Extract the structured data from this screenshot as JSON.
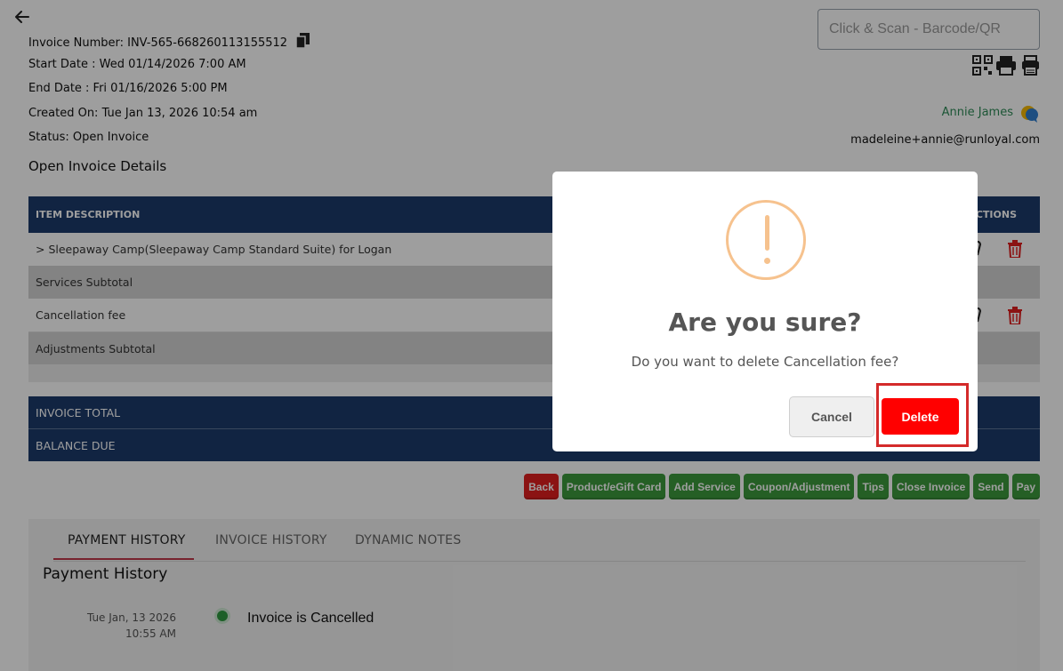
{
  "header": {
    "invoice_number": "Invoice Number: INV-565-668260113155512",
    "start_date": "Start Date : Wed 01/14/2026 7:00 AM",
    "end_date": "End Date : Fri 01/16/2026 5:00 PM",
    "created_on": "Created On: Tue Jan 13, 2026 10:54 am",
    "status": "Status: Open Invoice",
    "section_title": "Open Invoice Details"
  },
  "scan": {
    "placeholder": "Click & Scan - Barcode/QR"
  },
  "customer": {
    "name": "Annie James",
    "email": "madeleine+annie@runloyal.com"
  },
  "table": {
    "col_description": "ITEM DESCRIPTION",
    "col_actions": "ACTIONS",
    "rows": [
      {
        "label": ">  Sleepaway Camp(Sleepaway Camp Standard Suite) for Logan"
      },
      {
        "label": "Services Subtotal"
      },
      {
        "label": "Cancellation fee"
      },
      {
        "label": "Adjustments Subtotal"
      }
    ],
    "invoice_total": "INVOICE TOTAL",
    "balance_due": "BALANCE DUE"
  },
  "buttons": {
    "back": "Back",
    "product": "Product/eGift Card",
    "add_service": "Add Service",
    "coupon": "Coupon/Adjustment",
    "tips": "Tips",
    "close_invoice": "Close Invoice",
    "send": "Send",
    "pay": "Pay"
  },
  "tabs": [
    "PAYMENT HISTORY",
    "INVOICE HISTORY",
    "DYNAMIC NOTES"
  ],
  "payment_history": {
    "title": "Payment History",
    "entries": [
      {
        "date": "Tue Jan, 13 2026",
        "time": "10:55 AM",
        "text": "Invoice is Cancelled"
      }
    ]
  },
  "modal": {
    "title": "Are you sure?",
    "message": "Do you want to delete Cancellation fee?",
    "cancel": "Cancel",
    "confirm": "Delete"
  },
  "colors": {
    "navy": "#1c3a6b",
    "green_button": "#3c9a3c",
    "red_button": "#ff0000",
    "warning": "#f6c28e"
  }
}
